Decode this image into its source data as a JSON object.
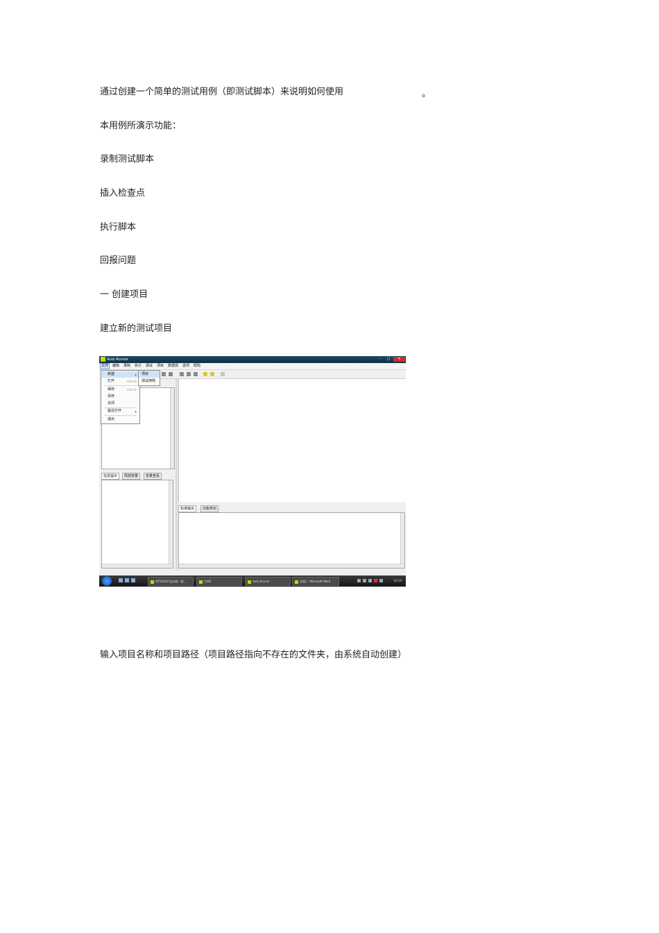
{
  "document": {
    "intro": "通过创建一个简单的测试用例（即测试脚本）来说明如何使用",
    "intro_tail": "。",
    "features_heading": "本用例所演示功能：",
    "features": [
      "录制测试脚本",
      "插入检查点",
      "执行脚本",
      "回报问题"
    ],
    "section_title": "一  创建项目",
    "step_text": "建立新的测试项目",
    "after_text": "输入项目名称和项目路径（项目路径指向不存在的文件夹，由系统自动创建）"
  },
  "screenshot": {
    "window_title": "Auto Runner",
    "window_buttons": {
      "minimize": "–",
      "maximize": "□",
      "close": "✕"
    },
    "menu": [
      "文件",
      "编辑",
      "录制",
      "执行",
      "调试",
      "项目",
      "数据源",
      "选项",
      "帮助"
    ],
    "file_menu": {
      "new": {
        "label": "新建",
        "arrow": "▸"
      },
      "open": {
        "label": "打开",
        "shortcut": "Ctrl+O"
      },
      "save": {
        "label": "保存",
        "shortcut": "Ctrl+S"
      },
      "save_as": {
        "label": "另存"
      },
      "close": {
        "label": "关闭"
      },
      "recent": {
        "label": "最近打开",
        "arrow": "▸"
      },
      "exit": {
        "label": "退出"
      }
    },
    "new_submenu": [
      "项目",
      "测试用例"
    ],
    "left_tabs": [
      "信息提示",
      "局部变量",
      "变量查看"
    ],
    "bottom_tabs": [
      "标准输出",
      "对象辨识"
    ],
    "taskbar": {
      "buttons": [
        "AIT2010产品文档 - 版...",
        "Ch02",
        "Auto Runner",
        "文档1 - Microsoft Word"
      ],
      "clock": "16:19"
    }
  }
}
